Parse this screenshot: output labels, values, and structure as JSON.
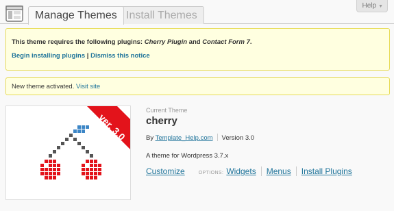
{
  "header": {
    "tabs": [
      {
        "label": "Manage Themes",
        "active": true
      },
      {
        "label": "Install Themes",
        "active": false
      }
    ],
    "help_label": "Help",
    "help_icon": "caret-down-icon"
  },
  "plugin_notice": {
    "text_prefix": "This theme requires the following plugins: ",
    "plugin1": "Cherry Plugin",
    "text_and": " and ",
    "plugin2": "Contact Form 7",
    "text_suffix": ".",
    "install_link": "Begin installing plugins",
    "separator": " | ",
    "dismiss_link": "Dismiss this notice"
  },
  "activation_notice": {
    "text": "New theme activated. ",
    "visit_link": "Visit site"
  },
  "theme": {
    "ribbon_text": "ver. 3.0",
    "current_label": "Current Theme",
    "name": "cherry",
    "by_prefix": "By ",
    "author": "Template_Help.com",
    "version": "Version 3.0",
    "description": "A theme for Wordpress 3.7.x",
    "customize_label": "Customize",
    "options_label": "OPTIONS:",
    "options": [
      "Widgets",
      "Menus",
      "Install Plugins"
    ]
  },
  "colors": {
    "link": "#21759b",
    "notice_bg": "#ffffe0",
    "notice_border": "#e6db55",
    "ribbon": "#e3131b",
    "cherry_red": "#e3131b",
    "stem": "#555555",
    "leaf": "#3d86c6"
  }
}
